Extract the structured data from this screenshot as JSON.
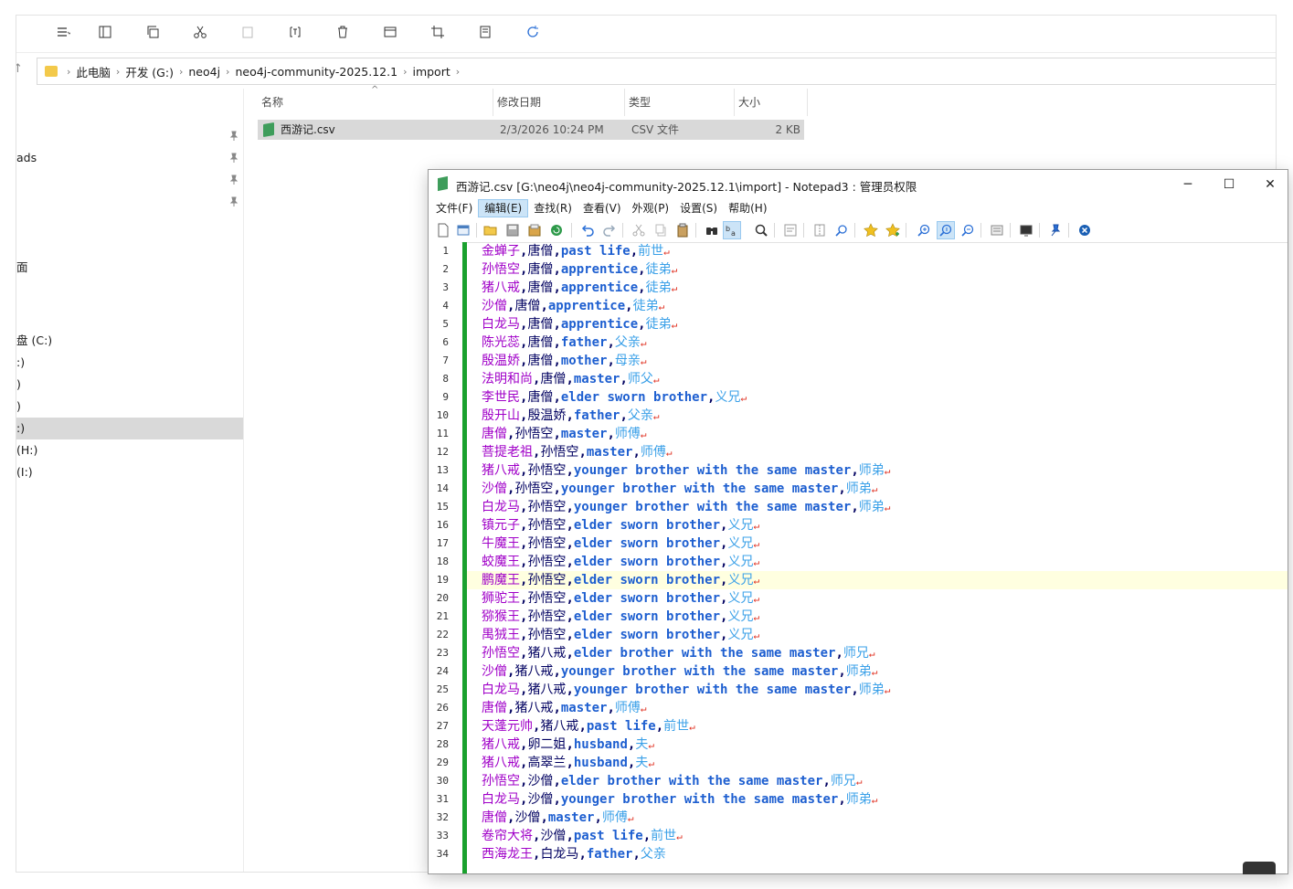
{
  "explorer": {
    "address": {
      "crumbs": [
        "此电脑",
        "开发 (G:)",
        "neo4j",
        "neo4j-community-2025.12.1",
        "import"
      ]
    },
    "nav": {
      "downloads": "ads",
      "desktop": "面",
      "drive_c": "盘 (C:)",
      "drive_d": ":)",
      "drive_e": ")",
      "drive_f": ")",
      "drive_g": ":)",
      "drive_h": "(H:)",
      "drive_i": "(I:)"
    },
    "columns": {
      "name": "名称",
      "modified": "修改日期",
      "type": "类型",
      "size": "大小"
    },
    "file": {
      "name": "西游记.csv",
      "modified": "2/3/2026 10:24 PM",
      "type": "CSV 文件",
      "size": "2 KB"
    }
  },
  "notepad": {
    "title": "西游记.csv [G:\\neo4j\\neo4j-community-2025.12.1\\import] - Notepad3 : 管理员权限",
    "menu": [
      "文件(F)",
      "编辑(E)",
      "查找(R)",
      "查看(V)",
      "外观(P)",
      "设置(S)",
      "帮助(H)"
    ],
    "active_menu": "编辑(E)",
    "current_line": 19,
    "colors": {
      "col0": "#a000c8",
      "col1": "#000060",
      "col2": "#1e5fd0",
      "col3": "#3aa0e8",
      "change_bar": "#1aa12e",
      "current_line": "#ffffe0"
    },
    "lines": [
      [
        "金蝉子",
        "唐僧",
        "past life",
        "前世"
      ],
      [
        "孙悟空",
        "唐僧",
        "apprentice",
        "徒弟"
      ],
      [
        "猪八戒",
        "唐僧",
        "apprentice",
        "徒弟"
      ],
      [
        "沙僧",
        "唐僧",
        "apprentice",
        "徒弟"
      ],
      [
        "白龙马",
        "唐僧",
        "apprentice",
        "徒弟"
      ],
      [
        "陈光蕊",
        "唐僧",
        "father",
        "父亲"
      ],
      [
        "殷温娇",
        "唐僧",
        "mother",
        "母亲"
      ],
      [
        "法明和尚",
        "唐僧",
        "master",
        "师父"
      ],
      [
        "李世民",
        "唐僧",
        "elder sworn brother",
        "义兄"
      ],
      [
        "殷开山",
        "殷温娇",
        "father",
        "父亲"
      ],
      [
        "唐僧",
        "孙悟空",
        "master",
        "师傅"
      ],
      [
        "菩提老祖",
        "孙悟空",
        "master",
        "师傅"
      ],
      [
        "猪八戒",
        "孙悟空",
        "younger brother with the same master",
        "师弟"
      ],
      [
        "沙僧",
        "孙悟空",
        "younger brother with the same master",
        "师弟"
      ],
      [
        "白龙马",
        "孙悟空",
        "younger brother with the same master",
        "师弟"
      ],
      [
        "镇元子",
        "孙悟空",
        "elder sworn brother",
        "义兄"
      ],
      [
        "牛魔王",
        "孙悟空",
        "elder sworn brother",
        "义兄"
      ],
      [
        "蛟魔王",
        "孙悟空",
        "elder sworn brother",
        "义兄"
      ],
      [
        "鹏魔王",
        "孙悟空",
        "elder sworn brother",
        "义兄"
      ],
      [
        "狮驼王",
        "孙悟空",
        "elder sworn brother",
        "义兄"
      ],
      [
        "猕猴王",
        "孙悟空",
        "elder sworn brother",
        "义兄"
      ],
      [
        "禺狨王",
        "孙悟空",
        "elder sworn brother",
        "义兄"
      ],
      [
        "孙悟空",
        "猪八戒",
        "elder brother with the same master",
        "师兄"
      ],
      [
        "沙僧",
        "猪八戒",
        "younger brother with the same master",
        "师弟"
      ],
      [
        "白龙马",
        "猪八戒",
        "younger brother with the same master",
        "师弟"
      ],
      [
        "唐僧",
        "猪八戒",
        "master",
        "师傅"
      ],
      [
        "天蓬元帅",
        "猪八戒",
        "past life",
        "前世"
      ],
      [
        "猪八戒",
        "卵二姐",
        "husband",
        "夫"
      ],
      [
        "猪八戒",
        "高翠兰",
        "husband",
        "夫"
      ],
      [
        "孙悟空",
        "沙僧",
        "elder brother with the same master",
        "师兄"
      ],
      [
        "白龙马",
        "沙僧",
        "younger brother with the same master",
        "师弟"
      ],
      [
        "唐僧",
        "沙僧",
        "master",
        "师傅"
      ],
      [
        "卷帘大将",
        "沙僧",
        "past life",
        "前世"
      ],
      [
        "西海龙王",
        "白龙马",
        "father",
        "父亲"
      ]
    ]
  }
}
